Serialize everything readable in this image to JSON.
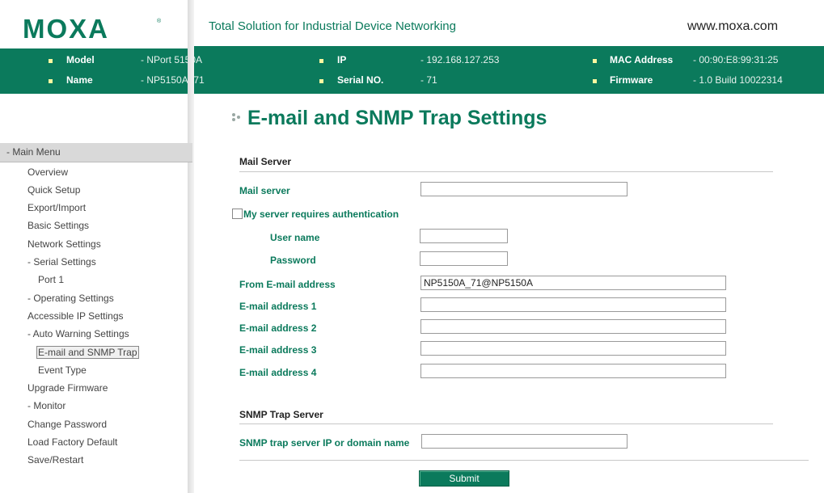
{
  "header": {
    "logo_text": "MOXA",
    "tagline": "Total Solution for Industrial Device Networking",
    "website": "www.moxa.com"
  },
  "info": {
    "model_label": "Model",
    "model_value": "- NPort 5150A",
    "name_label": "Name",
    "name_value": "- NP5150A_71",
    "ip_label": "IP",
    "ip_value": "- 192.168.127.253",
    "serial_label": "Serial NO.",
    "serial_value": "- 71",
    "mac_label": "MAC Address",
    "mac_value": "- 00:90:E8:99:31:25",
    "firmware_label": "Firmware",
    "firmware_value": "- 1.0 Build 10022314"
  },
  "sidebar": {
    "header": "- Main Menu",
    "items": [
      {
        "label": "Overview"
      },
      {
        "label": "Quick Setup"
      },
      {
        "label": "Export/Import"
      },
      {
        "label": "Basic Settings"
      },
      {
        "label": "Network Settings"
      },
      {
        "label": "- Serial Settings"
      },
      {
        "label": "Port 1"
      },
      {
        "label": "- Operating Settings"
      },
      {
        "label": "Accessible IP Settings"
      },
      {
        "label": "- Auto Warning Settings"
      },
      {
        "label": "E-mail and SNMP Trap"
      },
      {
        "label": "Event Type"
      },
      {
        "label": "Upgrade Firmware"
      },
      {
        "label": "- Monitor"
      },
      {
        "label": "Change Password"
      },
      {
        "label": "Load Factory Default"
      },
      {
        "label": "Save/Restart"
      }
    ]
  },
  "main": {
    "title": "E-mail and SNMP Trap Settings",
    "mail_section": "Mail Server",
    "mail_server_label": "Mail server",
    "mail_server_value": "",
    "auth_label": "My server requires authentication",
    "auth_checked": false,
    "username_label": "User name",
    "username_value": "",
    "password_label": "Password",
    "password_value": "",
    "from_label": "From E-mail address",
    "from_value": "NP5150A_71@NP5150A",
    "email1_label": "E-mail address 1",
    "email1_value": "",
    "email2_label": "E-mail address 2",
    "email2_value": "",
    "email3_label": "E-mail address 3",
    "email3_value": "",
    "email4_label": "E-mail address 4",
    "email4_value": "",
    "snmp_section": "SNMP Trap Server",
    "snmp_label": "SNMP trap server IP or domain name",
    "snmp_value": "",
    "submit_label": "Submit"
  },
  "colors": {
    "brand_green": "#0b7a5c",
    "bullet_yellow": "#fff7a0"
  }
}
